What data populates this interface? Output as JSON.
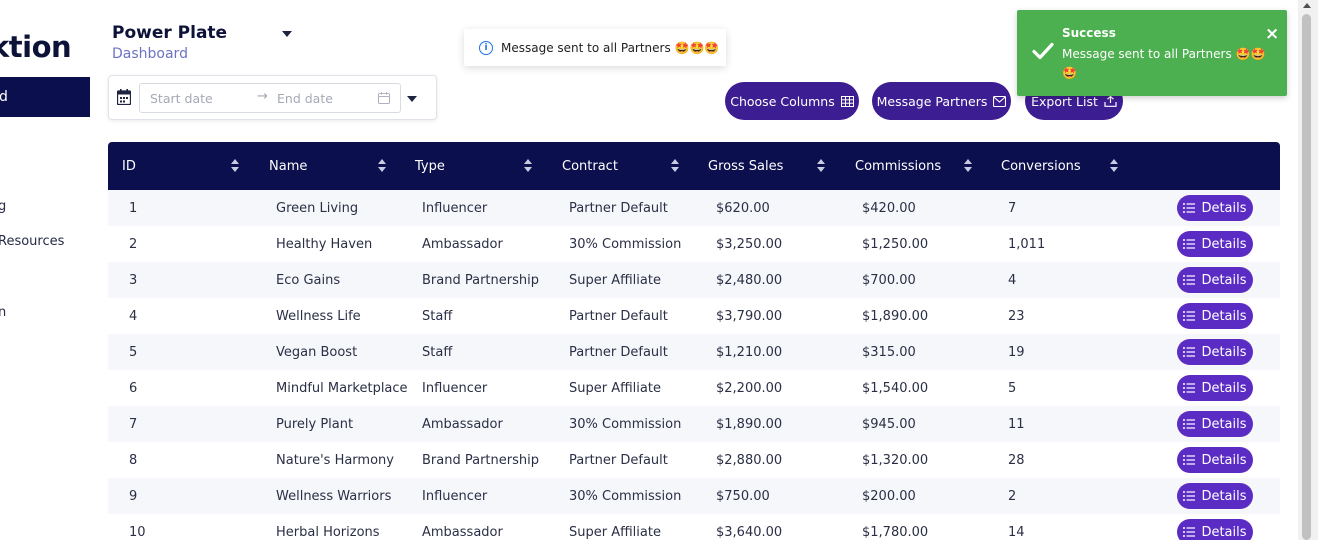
{
  "sidebar": {
    "brand": "ktion",
    "active_item": "d",
    "items": [
      "g",
      "Resources",
      "n"
    ]
  },
  "header": {
    "title": "Power Plate",
    "subtitle": "Dashboard"
  },
  "date_range": {
    "start_placeholder": "Start date",
    "end_placeholder": "End date",
    "arrow": "→"
  },
  "info_toast": {
    "text": "Message sent to all Partners 🤩🤩🤩"
  },
  "actions": {
    "choose_columns": "Choose Columns",
    "message_partners": "Message Partners",
    "export_list": "Export List"
  },
  "success_toast": {
    "title": "Success",
    "message": "Message sent to all Partners 🤩🤩🤩",
    "close": "×",
    "color": "#4caf50"
  },
  "table": {
    "headers": [
      "ID",
      "Name",
      "Type",
      "Contract",
      "Gross Sales",
      "Commissions",
      "Conversions"
    ],
    "details_label": "Details",
    "rows": [
      [
        "1",
        "Green Living",
        "Influencer",
        "Partner Default",
        "$620.00",
        "$420.00",
        "7"
      ],
      [
        "2",
        "Healthy Haven",
        "Ambassador",
        "30% Commission",
        "$3,250.00",
        "$1,250.00",
        "1,011"
      ],
      [
        "3",
        "Eco Gains",
        "Brand Partnership",
        "Super Affiliate",
        "$2,480.00",
        "$700.00",
        "4"
      ],
      [
        "4",
        "Wellness Life",
        "Staff",
        "Partner Default",
        "$3,790.00",
        "$1,890.00",
        "23"
      ],
      [
        "5",
        "Vegan Boost",
        "Staff",
        "Partner Default",
        "$1,210.00",
        "$315.00",
        "19"
      ],
      [
        "6",
        "Mindful Marketplace",
        "Influencer",
        "Super Affiliate",
        "$2,200.00",
        "$1,540.00",
        "5"
      ],
      [
        "7",
        "Purely Plant",
        "Ambassador",
        "30% Commission",
        "$1,890.00",
        "$945.00",
        "11"
      ],
      [
        "8",
        "Nature's Harmony",
        "Brand Partnership",
        "Partner Default",
        "$2,880.00",
        "$1,320.00",
        "28"
      ],
      [
        "9",
        "Wellness Warriors",
        "Influencer",
        "30% Commission",
        "$750.00",
        "$200.00",
        "2"
      ],
      [
        "10",
        "Herbal Horizons",
        "Ambassador",
        "Super Affiliate",
        "$3,640.00",
        "$1,780.00",
        "14"
      ]
    ]
  },
  "colors": {
    "navy": "#0b0f4e",
    "purple_button": "#3d1d92",
    "details_button": "#5b2cc4"
  }
}
